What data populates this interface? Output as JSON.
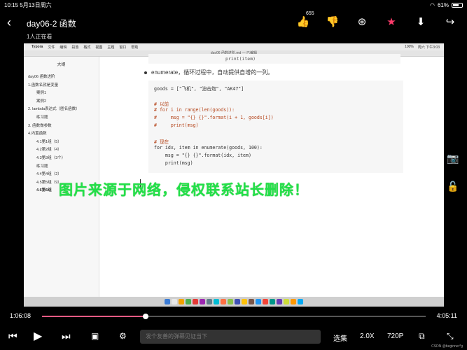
{
  "status_bar": {
    "time": "10:15",
    "date": "5月13日周六",
    "battery": "61%"
  },
  "header": {
    "title": "day06-2 函数",
    "viewers": "1人正在看",
    "like_count": "655"
  },
  "icons": {
    "back": "‹",
    "like": "👍",
    "dislike": "👎",
    "coin": "⊛",
    "star": "★",
    "download": "⬇",
    "share": "↪",
    "camera": "📷",
    "lock": "🔓",
    "prev": "⏮",
    "play": "▶",
    "next": "⏭"
  },
  "mac": {
    "menus": [
      "Typora",
      "文件",
      "编辑",
      "段落",
      "格式",
      "视图",
      "主题",
      "窗口",
      "帮助"
    ],
    "menubar_right": [
      "100%",
      "周六 下午3:03"
    ],
    "window_title": "day06 函数进阶.md — 已编辑"
  },
  "outline": {
    "title": "大纲",
    "items": [
      {
        "label": "day06 函数进阶",
        "level": 1,
        "active": false
      },
      {
        "label": "1.函数名就是变量",
        "level": 1,
        "active": false
      },
      {
        "label": "案例1",
        "level": 2,
        "active": false
      },
      {
        "label": "案例2",
        "level": 2,
        "active": false
      },
      {
        "label": "2. lambda表达式（匿名函数）",
        "level": 1,
        "active": false
      },
      {
        "label": "练习题",
        "level": 2,
        "active": false
      },
      {
        "label": "3. 函数做参数",
        "level": 1,
        "active": false
      },
      {
        "label": "4.内置函数",
        "level": 1,
        "active": false
      },
      {
        "label": "4.1第1组（5）",
        "level": 2,
        "active": false
      },
      {
        "label": "4.2第2组（4）",
        "level": 2,
        "active": false
      },
      {
        "label": "4.3第3组（3个）",
        "level": 2,
        "active": false
      },
      {
        "label": "练习题",
        "level": 2,
        "active": false
      },
      {
        "label": "4.4第4组（2）",
        "level": 2,
        "active": false
      },
      {
        "label": "4.5第5组（9）",
        "level": 2,
        "active": false
      },
      {
        "label": "4.6第6组",
        "level": 2,
        "active": true
      }
    ]
  },
  "editor": {
    "code_top": "print(item)",
    "bullet": "enumerate，循环过程中，自动提供自增的一列。",
    "code_lines": [
      {
        "text": "goods = [\"飞机\", \"迫击炮\", \"AK47\"]",
        "kind": "code"
      },
      {
        "text": "",
        "kind": "code"
      },
      {
        "text": "# 以前",
        "kind": "cm"
      },
      {
        "text": "# for i in range(len(goods)):",
        "kind": "cm"
      },
      {
        "text": "#     msg = \"{} {}\".format(i + 1, goods[i])",
        "kind": "cm"
      },
      {
        "text": "#     print(msg)",
        "kind": "cm"
      },
      {
        "text": "",
        "kind": "code"
      },
      {
        "text": "# 现在",
        "kind": "cm"
      },
      {
        "text": "for idx, item in enumerate(goods, 100):",
        "kind": "code"
      },
      {
        "text": "    msg = \"{} {}\".format(idx, item)",
        "kind": "code"
      },
      {
        "text": "    print(msg)",
        "kind": "code"
      }
    ]
  },
  "watermark": "图片来源于网络，侵权联系站长删除！",
  "progress": {
    "current": "1:06:08",
    "total": "4:05:11",
    "fraction": 0.27
  },
  "controls": {
    "danmaku_placeholder": "发个友善的弹幕见证当下",
    "select_episode": "选集",
    "speed": "2.0X",
    "quality": "720P"
  },
  "credit": "CSDN @beginner*g",
  "dock_colors": [
    "#3a7bd5",
    "#e8e8e8",
    "#f2a100",
    "#4caf50",
    "#e53935",
    "#9c27b0",
    "#607d8b",
    "#00bcd4",
    "#ff7043",
    "#8bc34a",
    "#3f51b5",
    "#ffc107",
    "#795548",
    "#2196f3",
    "#f44336",
    "#009688",
    "#673ab7",
    "#cddc39",
    "#ff9800",
    "#03a9f4"
  ]
}
